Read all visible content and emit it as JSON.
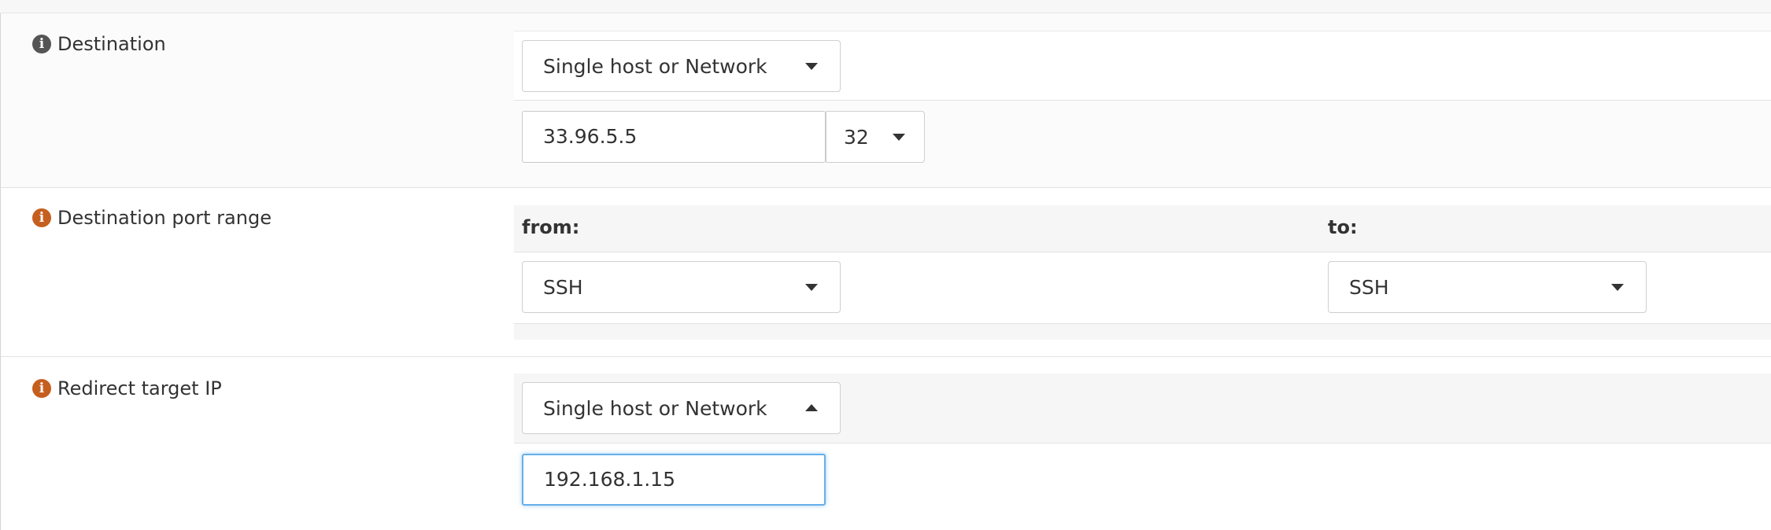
{
  "destination": {
    "label": "Destination",
    "type_value": "Single host or Network",
    "address_value": "33.96.5.5",
    "mask_value": "32"
  },
  "port_range": {
    "label": "Destination port range",
    "from_label": "from:",
    "to_label": "to:",
    "from_value": "SSH",
    "to_value": "SSH"
  },
  "redirect": {
    "label": "Redirect target IP",
    "type_value": "Single host or Network",
    "address_value": "192.168.1.15"
  },
  "icons": {
    "info_default": "info-icon",
    "info_accent": "info-icon",
    "colors": {
      "info_gray": "#555555",
      "info_orange": "#c55f1f",
      "focus_blue": "#66afe9"
    }
  }
}
